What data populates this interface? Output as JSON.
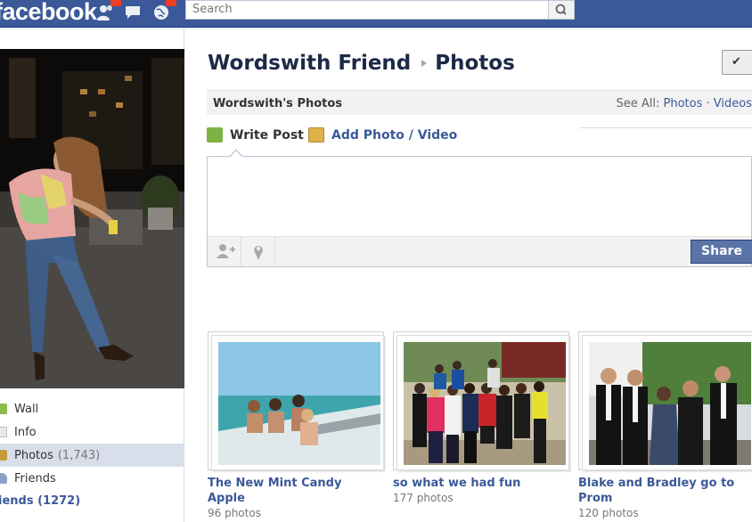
{
  "topbar": {
    "logo": "facebook",
    "search_placeholder": "Search"
  },
  "profile": {
    "nav": [
      {
        "label": "Wall",
        "count": ""
      },
      {
        "label": "Info",
        "count": ""
      },
      {
        "label": "Photos",
        "count": "(1,743)"
      },
      {
        "label": "Friends",
        "count": ""
      }
    ],
    "friends_label": "iends (1272)"
  },
  "main": {
    "title_name": "Wordswith Friend",
    "title_section": "Photos",
    "edit_label": "✔",
    "header": {
      "title": "Wordswith's Photos",
      "see_all_prefix": "See All:",
      "see_all_photos": "Photos",
      "see_all_sep": "·",
      "see_all_videos": "Videos"
    },
    "composer": {
      "write_post": "Write Post",
      "add_photo": "Add Photo / Video",
      "share": "Share"
    },
    "albums": [
      {
        "name": "The New Mint Candy Apple",
        "count": "96 photos"
      },
      {
        "name": "so what we had fun",
        "count": "177 photos"
      },
      {
        "name": "Blake and Bradley go to Prom",
        "count": "120 photos"
      }
    ]
  },
  "colors": {
    "brand_blue": "#3b5998",
    "title_navy": "#1c2a47",
    "share_button": "#5b74a8"
  }
}
